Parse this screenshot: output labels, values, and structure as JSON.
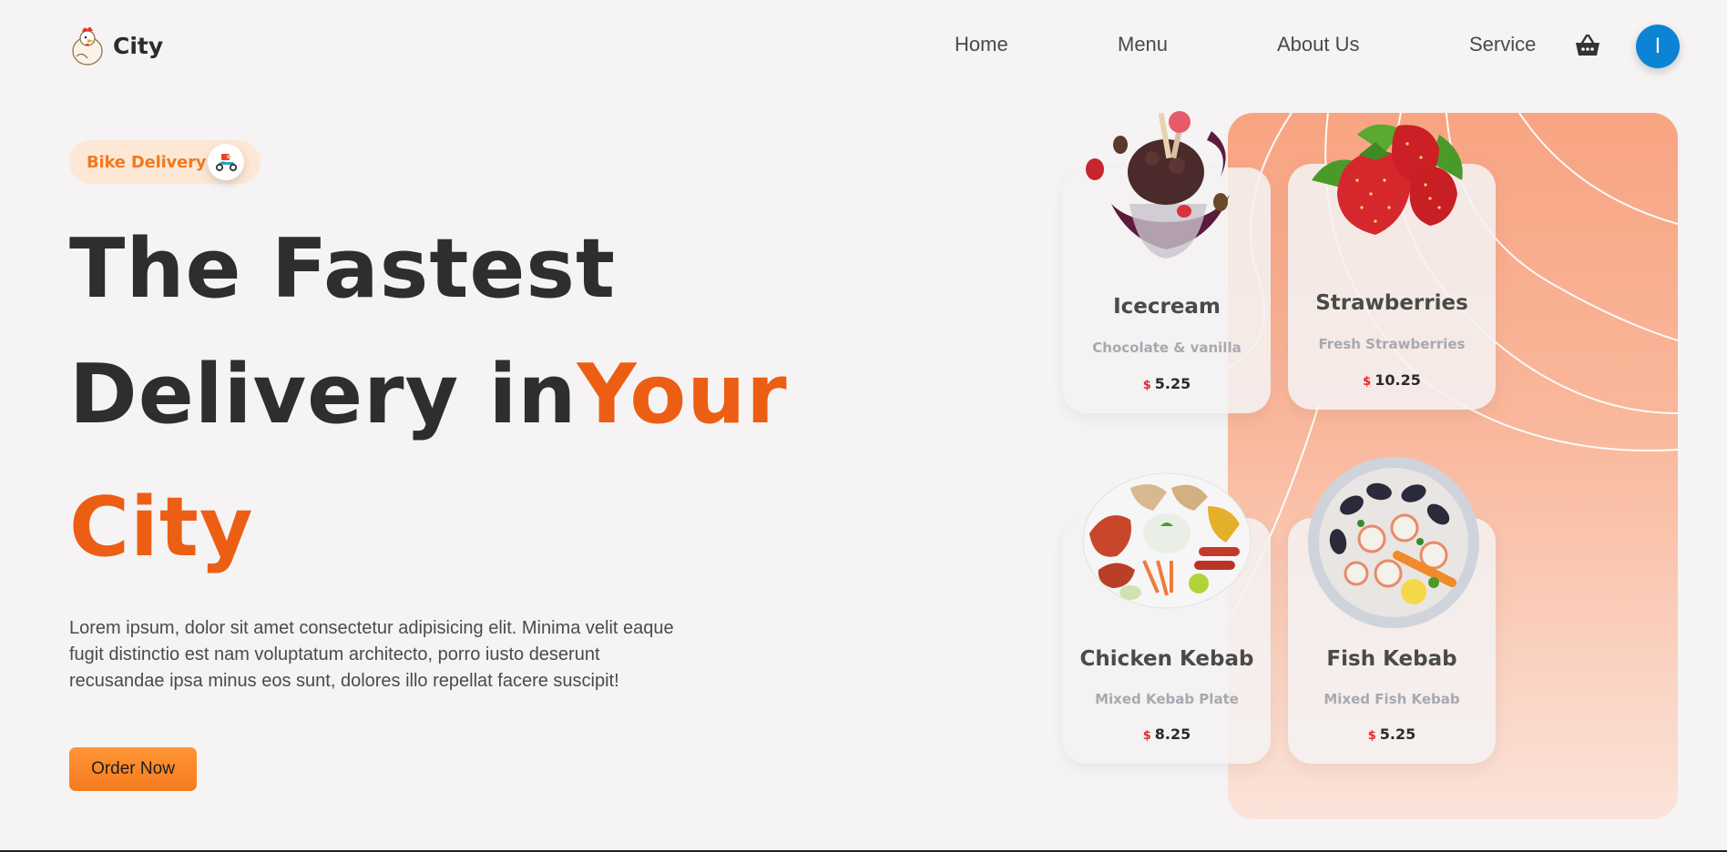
{
  "header": {
    "brand": "City",
    "nav": [
      {
        "label": "Home"
      },
      {
        "label": "Menu"
      },
      {
        "label": "About Us"
      },
      {
        "label": "Service"
      }
    ],
    "avatar_initial": "I"
  },
  "hero": {
    "badge": "Bike Delivery",
    "headline_1": "The Fastest",
    "headline_2a": "Delivery in",
    "headline_2b": "Your",
    "headline_3": "City",
    "description": "Lorem ipsum, dolor sit amet consectetur adipisicing elit. Minima velit eaque fugit distinctio est nam voluptatum architecto, porro iusto deserunt recusandae ipsa minus eos sunt, dolores illo repellat facere suscipit!",
    "cta": "Order Now"
  },
  "menu_cards": [
    {
      "title": "Icecream",
      "subtitle": "Chocolate & vanilla",
      "currency": "$",
      "price": "5.25",
      "image_icon": "icecream-image"
    },
    {
      "title": "Strawberries",
      "subtitle": "Fresh Strawberries",
      "currency": "$",
      "price": "10.25",
      "image_icon": "strawberries-image"
    },
    {
      "title": "Chicken Kebab",
      "subtitle": "Mixed Kebab Plate",
      "currency": "$",
      "price": "8.25",
      "image_icon": "chicken-kebab-image"
    },
    {
      "title": "Fish Kebab",
      "subtitle": "Mixed Fish Kebab",
      "currency": "$",
      "price": "5.25",
      "image_icon": "fish-kebab-image"
    }
  ],
  "colors": {
    "accent": "#ec5e14",
    "button": "#f7841f",
    "avatar": "#0b84d5",
    "panel": "#f8a482",
    "price_currency": "#e22a2a"
  }
}
